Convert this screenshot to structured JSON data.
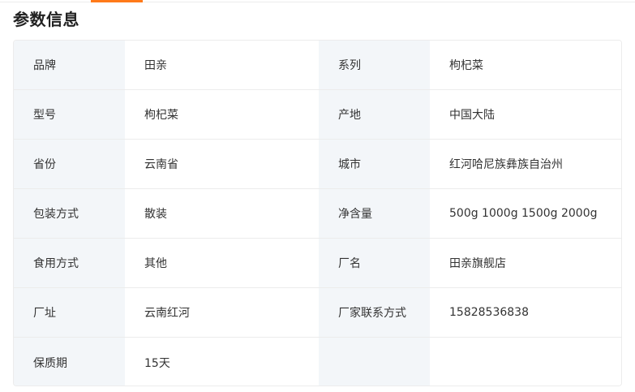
{
  "section": {
    "title": "参数信息"
  },
  "params": [
    {
      "label_left": "品牌",
      "value_left": "田亲",
      "label_right": "系列",
      "value_right": "枸杞菜"
    },
    {
      "label_left": "型号",
      "value_left": "枸杞菜",
      "label_right": "产地",
      "value_right": "中国大陆"
    },
    {
      "label_left": "省份",
      "value_left": "云南省",
      "label_right": "城市",
      "value_right": "红河哈尼族彝族自治州"
    },
    {
      "label_left": "包装方式",
      "value_left": "散装",
      "label_right": "净含量",
      "value_right": "500g 1000g 1500g 2000g"
    },
    {
      "label_left": "食用方式",
      "value_left": "其他",
      "label_right": "厂名",
      "value_right": "田亲旗舰店"
    },
    {
      "label_left": "厂址",
      "value_left": "云南红河",
      "label_right": "厂家联系方式",
      "value_right": "15828536838"
    },
    {
      "label_left": "保质期",
      "value_left": "15天",
      "label_right": "",
      "value_right": ""
    }
  ]
}
